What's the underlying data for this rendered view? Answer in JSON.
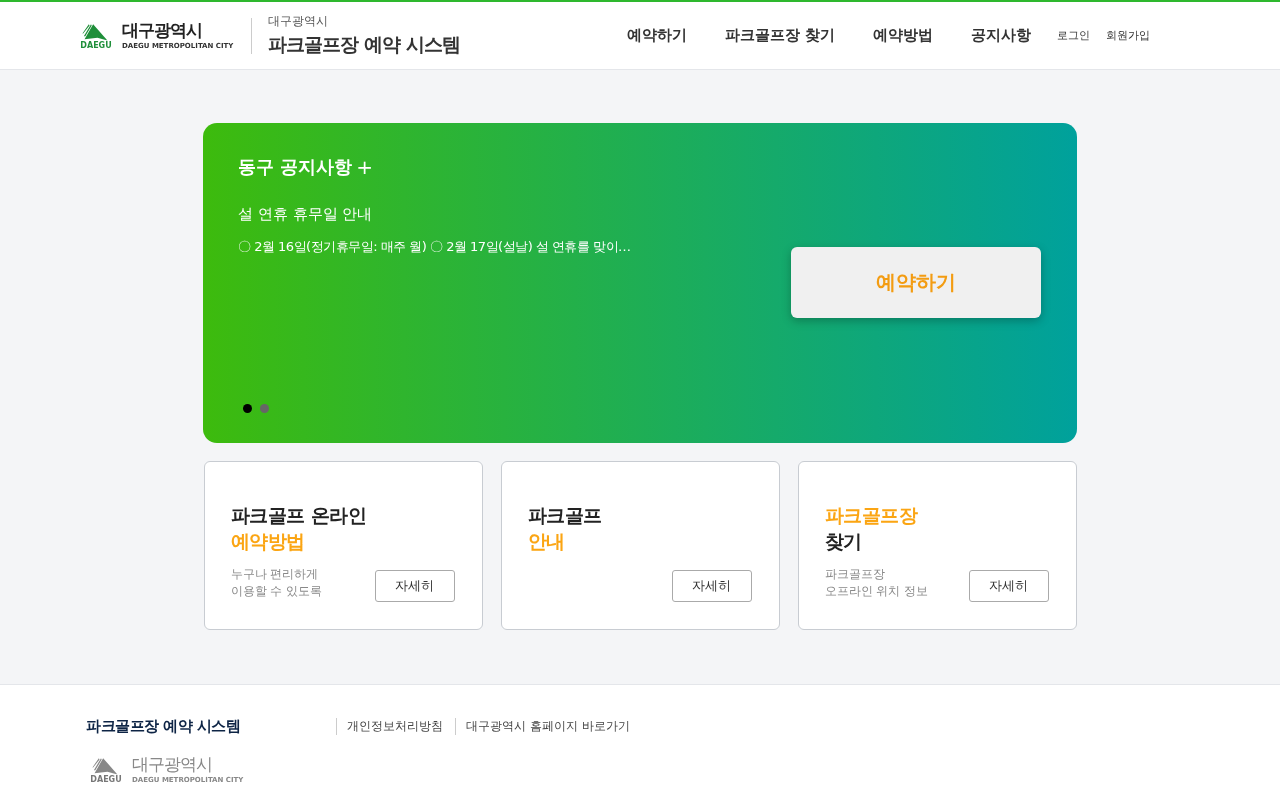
{
  "header": {
    "logo": {
      "badge": "DAEGU",
      "name": "대구광역시",
      "subname": "DAEGU METROPOLITAN CITY"
    },
    "site_caption": "대구광역시",
    "site_title": "파크골프장 예약 시스템",
    "nav": [
      {
        "label": "예약하기"
      },
      {
        "label": "파크골프장 찾기"
      },
      {
        "label": "예약방법"
      },
      {
        "label": "공지사항"
      }
    ],
    "util_links": [
      {
        "label": "로그인"
      },
      {
        "label": "회원가입"
      }
    ]
  },
  "banner": {
    "title": "동구 공지사항",
    "plus": "+",
    "notice_title": "설 연휴 휴무일 안내",
    "notice_body": "〇 2월 16일(정기휴무일: 매주 월) 〇 2월 17일(설날) 설 연휴를 맞이…",
    "button": "예약하기",
    "dots": [
      {
        "selected": true
      },
      {
        "selected": false
      }
    ]
  },
  "cards": [
    {
      "title": [
        {
          "text": "파크골프 온라인",
          "highlight": false
        },
        {
          "text": "예약방법",
          "highlight": true
        }
      ],
      "description": [
        "누구나 편리하게",
        "이용할 수 있도록"
      ],
      "button": "자세히"
    },
    {
      "title": [
        {
          "text": "파크골프",
          "highlight": false
        },
        {
          "text": "안내",
          "highlight": true
        }
      ],
      "button": "자세히"
    },
    {
      "title": [
        {
          "text": "파크골프장",
          "highlight": true
        },
        {
          "text": "찾기",
          "highlight": false
        }
      ],
      "description": [
        "파크골프장",
        "오프라인 위치 정보"
      ],
      "button": "자세히"
    }
  ],
  "footer": {
    "title": "파크골프장 예약 시스템",
    "links": [
      {
        "label": "개인정보처리방침"
      },
      {
        "label": "대구광역시 홈페이지 바로가기"
      }
    ],
    "logo": {
      "badge": "DAEGU",
      "name": "대구광역시",
      "subname": "DAEGU METROPOLITAN CITY"
    }
  }
}
